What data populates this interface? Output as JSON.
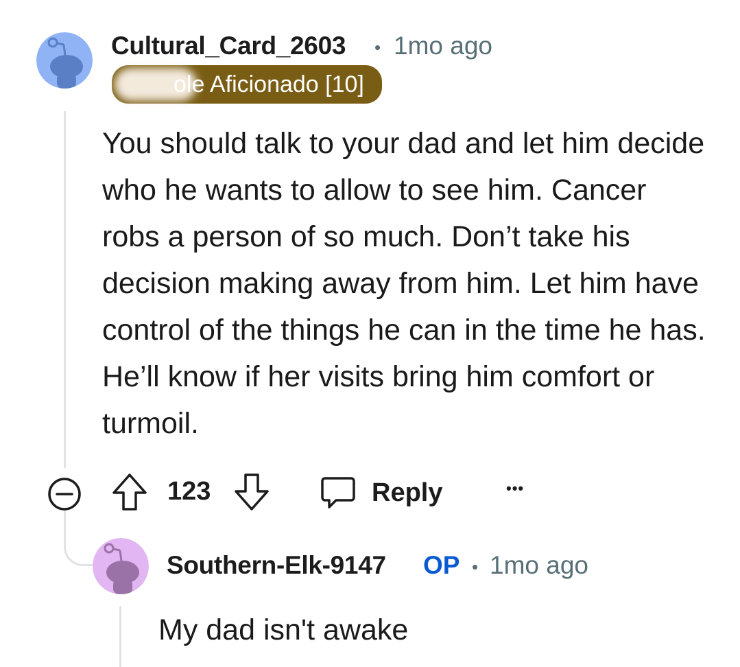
{
  "comment": {
    "username": "Cultural_Card_2603",
    "time": "1mo ago",
    "flair": "ole Aficionado [10]",
    "body": "You should talk to your dad and let him decide who he wants to allow to see him. Cancer robs a person of so much. Don’t take his decision making away from him. Let him have control of the things he can in the time he has. He’ll know if her visits bring him comfort or turmoil.",
    "avatar_color": "#8fb3f5",
    "icons": {
      "collapse": "collapse-minus-icon",
      "upvote": "upvote-arrow-icon",
      "downvote": "downvote-arrow-icon",
      "reply": "speech-bubble-icon",
      "more": "more-options-icon"
    }
  },
  "actions": {
    "score": "123",
    "reply_label": "Reply",
    "more_label": "•••"
  },
  "reply": {
    "username": "Southern-Elk-9147",
    "op_badge": "OP",
    "time": "1mo ago",
    "body": "My dad isn't awake",
    "avatar_color": "#e2b6f2"
  },
  "colors": {
    "flair_bg": "#7a5d14",
    "meta_text": "#576f76",
    "op_blue": "#0a5bd1"
  }
}
